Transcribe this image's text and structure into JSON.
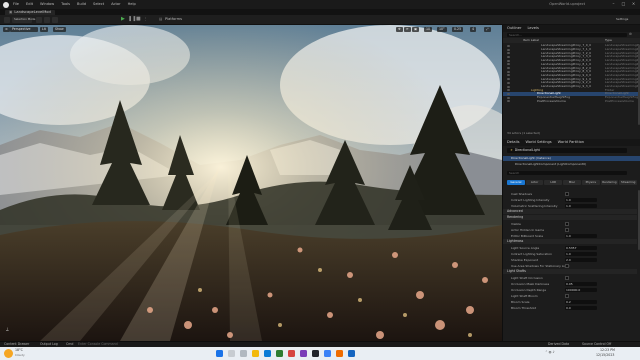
{
  "titlebar": {
    "menu": [
      "File",
      "Edit",
      "Window",
      "Tools",
      "Build",
      "Select",
      "Actor",
      "Help"
    ],
    "project": "OpenWorld.uproject"
  },
  "tab": {
    "label": "LandscapeLevelMod"
  },
  "toolbar": {
    "mode_label": "Selection Mode",
    "platforms_label": "Platforms",
    "settings_label": "Settings"
  },
  "viewport": {
    "perspective_label": "Perspective",
    "lit_label": "Lit",
    "show_label": "Show",
    "grid_value": "10",
    "angle_value": "10°",
    "scale_value": "0.25",
    "camera_speed": "4"
  },
  "outliner": {
    "tabs": [
      "Outliner",
      "Levels"
    ],
    "search_placeholder": "Search...",
    "col_item": "Item Label",
    "col_type": "Type",
    "rows": [
      {
        "name": "LandscapeStreamingProxy_7_0_0",
        "type": "LandscapeStreamingProxy"
      },
      {
        "name": "LandscapeStreamingProxy_7_1_0",
        "type": "LandscapeStreamingProxy"
      },
      {
        "name": "LandscapeStreamingProxy_7_2_0",
        "type": "LandscapeStreamingProxy"
      },
      {
        "name": "LandscapeStreamingProxy_7_3_0",
        "type": "LandscapeStreamingProxy"
      },
      {
        "name": "LandscapeStreamingProxy_8_0_0",
        "type": "LandscapeStreamingProxy"
      },
      {
        "name": "LandscapeStreamingProxy_8_1_0",
        "type": "LandscapeStreamingProxy"
      },
      {
        "name": "LandscapeStreamingProxy_8_2_0",
        "type": "LandscapeStreamingProxy"
      },
      {
        "name": "LandscapeStreamingProxy_8_3_0",
        "type": "LandscapeStreamingProxy"
      },
      {
        "name": "LandscapeStreamingProxy_9_0_0",
        "type": "LandscapeStreamingProxy"
      },
      {
        "name": "LandscapeStreamingProxy_9_1_0",
        "type": "LandscapeStreamingProxy"
      },
      {
        "name": "LandscapeStreamingProxy_9_2_0",
        "type": "LandscapeStreamingProxy"
      },
      {
        "name": "LandscapeStreamingProxy_9_3_0",
        "type": "LandscapeStreamingProxy"
      },
      {
        "name": "Lighting",
        "type": "Folder"
      },
      {
        "name": "DirectionalLight",
        "type": "DirectionalLight"
      },
      {
        "name": "ExponentialHeightFog",
        "type": "ExponentialHeightFog"
      },
      {
        "name": "PostProcessVolume",
        "type": "PostProcessVolume"
      }
    ],
    "selected_index": 13,
    "footer": "34 actors (1 selected)"
  },
  "details": {
    "tabs": [
      "Details",
      "World Settings",
      "World Partition"
    ],
    "actor_name": "DirectionalLight",
    "component_root": "DirectionalLight (Instance)",
    "component_child": "DirectionalLightComponent (LightComponent0)",
    "search_placeholder": "Search",
    "filter_tabs": [
      "General",
      "Actor",
      "LOD",
      "Misc",
      "Physics",
      "Rendering",
      "Streaming"
    ],
    "fields_top": [
      {
        "label": "Cast Shadows",
        "kind": "check"
      },
      {
        "label": "Indirect Lighting Intensity",
        "value": "1.0"
      },
      {
        "label": "Volumetric Scattering Intensity",
        "value": "1.0"
      }
    ],
    "cat_advanced": "Advanced",
    "cat_rendering": "Rendering",
    "fields_rendering": [
      {
        "label": "Visible",
        "kind": "check"
      },
      {
        "label": "Actor Hidden In Game",
        "kind": "check"
      },
      {
        "label": "Editor Billboard Scale",
        "value": "1.0"
      }
    ],
    "cat_lightmass": "Lightmass",
    "fields_lightmass": [
      {
        "label": "Light Source Angle",
        "value": "0.5357"
      },
      {
        "label": "Indirect Lighting Saturation",
        "value": "1.0"
      },
      {
        "label": "Shadow Exponent",
        "value": "2.0"
      },
      {
        "label": "Use Area Shadows For Stationary Light",
        "kind": "check"
      }
    ],
    "cat_light_shafts": "Light Shafts",
    "fields_shafts": [
      {
        "label": "Light Shaft Occlusion",
        "kind": "check"
      },
      {
        "label": "Occlusion Mask Darkness",
        "value": "0.05"
      },
      {
        "label": "Occlusion Depth Range",
        "value": "100000.0"
      },
      {
        "label": "Light Shaft Bloom",
        "kind": "check"
      },
      {
        "label": "Bloom Scale",
        "value": "0.2"
      },
      {
        "label": "Bloom Threshold",
        "value": "0.0"
      }
    ]
  },
  "bottombar": {
    "content_drawer": "Content Drawer",
    "output_log": "Output Log",
    "cmd": "Cmd",
    "console_placeholder": "Enter Console Command",
    "derived_data": "Derived Data",
    "source_control": "Source Control Off"
  },
  "taskbar": {
    "weather_temp": "18°C",
    "weather_text": "Cloudy",
    "time": "12:23 PM",
    "date": "12/15/2023"
  }
}
